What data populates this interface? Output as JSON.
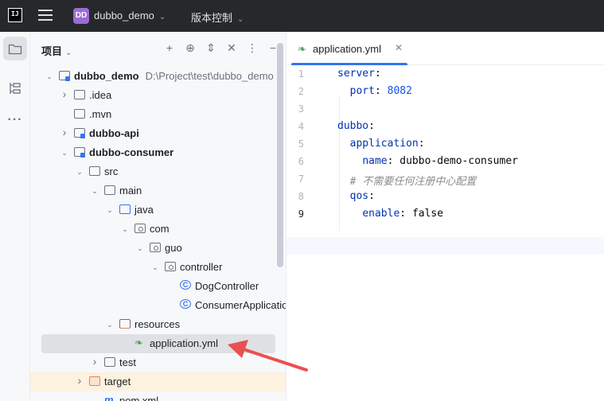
{
  "titlebar": {
    "project_badge": "DD",
    "project_name": "dubbo_demo",
    "vcs_label": "版本控制"
  },
  "project_panel": {
    "title": "项目",
    "tree": [
      {
        "label": "dubbo_demo",
        "path": "D:\\Project\\test\\dubbo_demo",
        "bold": true,
        "expanded": true,
        "kind": "module"
      },
      {
        "label": ".idea",
        "expanded": false,
        "kind": "folder"
      },
      {
        "label": ".mvn",
        "kind": "folder"
      },
      {
        "label": "dubbo-api",
        "bold": true,
        "expanded": false,
        "kind": "module"
      },
      {
        "label": "dubbo-consumer",
        "bold": true,
        "expanded": true,
        "kind": "module"
      },
      {
        "label": "src",
        "expanded": true,
        "kind": "folder"
      },
      {
        "label": "main",
        "expanded": true,
        "kind": "folder"
      },
      {
        "label": "java",
        "expanded": true,
        "kind": "source-folder"
      },
      {
        "label": "com",
        "expanded": true,
        "kind": "package"
      },
      {
        "label": "guo",
        "expanded": true,
        "kind": "package"
      },
      {
        "label": "controller",
        "expanded": true,
        "kind": "package"
      },
      {
        "label": "DogController",
        "kind": "class"
      },
      {
        "label": "ConsumerApplication",
        "kind": "spring-class"
      },
      {
        "label": "resources",
        "expanded": true,
        "kind": "resources-folder"
      },
      {
        "label": "application.yml",
        "kind": "yml",
        "selected": true
      },
      {
        "label": "test",
        "expanded": false,
        "kind": "folder"
      },
      {
        "label": "target",
        "expanded": false,
        "kind": "excluded-folder"
      },
      {
        "label": "pom.xml",
        "kind": "maven"
      }
    ]
  },
  "editor": {
    "tab_label": "application.yml",
    "line_numbers": [
      "1",
      "2",
      "3",
      "4",
      "5",
      "6",
      "7",
      "8",
      "9"
    ],
    "current_line": "9",
    "lines": [
      {
        "key": "server",
        "sep": ":",
        "value": ""
      },
      {
        "indent": "  ",
        "key": "port",
        "sep": ": ",
        "value": "8082"
      },
      {
        "key": "",
        "sep": "",
        "value": ""
      },
      {
        "key": "dubbo",
        "sep": ":",
        "value": ""
      },
      {
        "indent": "  ",
        "key": "application",
        "sep": ":",
        "value": ""
      },
      {
        "indent": "    ",
        "key": "name",
        "sep": ": ",
        "value": "dubbo-demo-consumer"
      },
      {
        "indent": "  ",
        "comment": "# 不需要任何注册中心配置"
      },
      {
        "indent": "  ",
        "key": "qos",
        "sep": ":",
        "value": ""
      },
      {
        "indent": "    ",
        "key": "enable",
        "sep": ": ",
        "value": "false"
      }
    ]
  },
  "colors": {
    "accent": "#3574f0",
    "arrow": "#e8514f",
    "yaml_key": "#0033b3"
  }
}
